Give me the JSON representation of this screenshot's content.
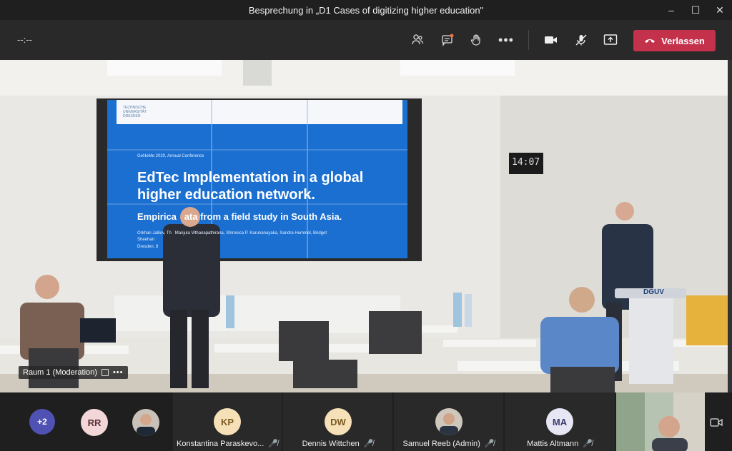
{
  "window": {
    "title": "Besprechung in „D1 Cases of digitizing higher education\""
  },
  "toolbar": {
    "timer": "--:--",
    "leave_label": "Verlassen"
  },
  "stage": {
    "label": "Raum 1 (Moderation)",
    "slide": {
      "conference": "GeNeMe 2020, Annual Conference",
      "title_line1": "EdTec Implementation in a global",
      "title_line2": "higher education network.",
      "subtitle": "Empirica   ata from a field study in South Asia.",
      "authors": "Orkhan Jalilov, Th   Manjula Vithanapathirana, Shironica P. Karunanayaka, Sandra Hummel, Bridget",
      "authors2": "Sheehan",
      "place": "Dresden, 8",
      "logo": "TECHNISCHE\nUNIVERSITÄT\nDRESDEN"
    },
    "clock": "14:07",
    "podium_brand": "DGUV"
  },
  "participants": {
    "overflow_count": "+2",
    "rr_initials": "RR",
    "tiles": [
      {
        "initials": "KP",
        "name": "Konstantina Paraskevo..."
      },
      {
        "initials": "DW",
        "name": "Dennis Wittchen"
      },
      {
        "initials": "",
        "name": "Samuel Reeb (Admin)"
      },
      {
        "initials": "MA",
        "name": "Mattis Altmann"
      }
    ]
  },
  "colors": {
    "leave": "#c4314b",
    "slide_blue": "#1a6fd1",
    "overflow_avatar": "#4f52b2",
    "initials_avatar": "#f6e0b8",
    "rr_avatar": "#f3d6d8",
    "ma_avatar": "#e6e6f5"
  }
}
